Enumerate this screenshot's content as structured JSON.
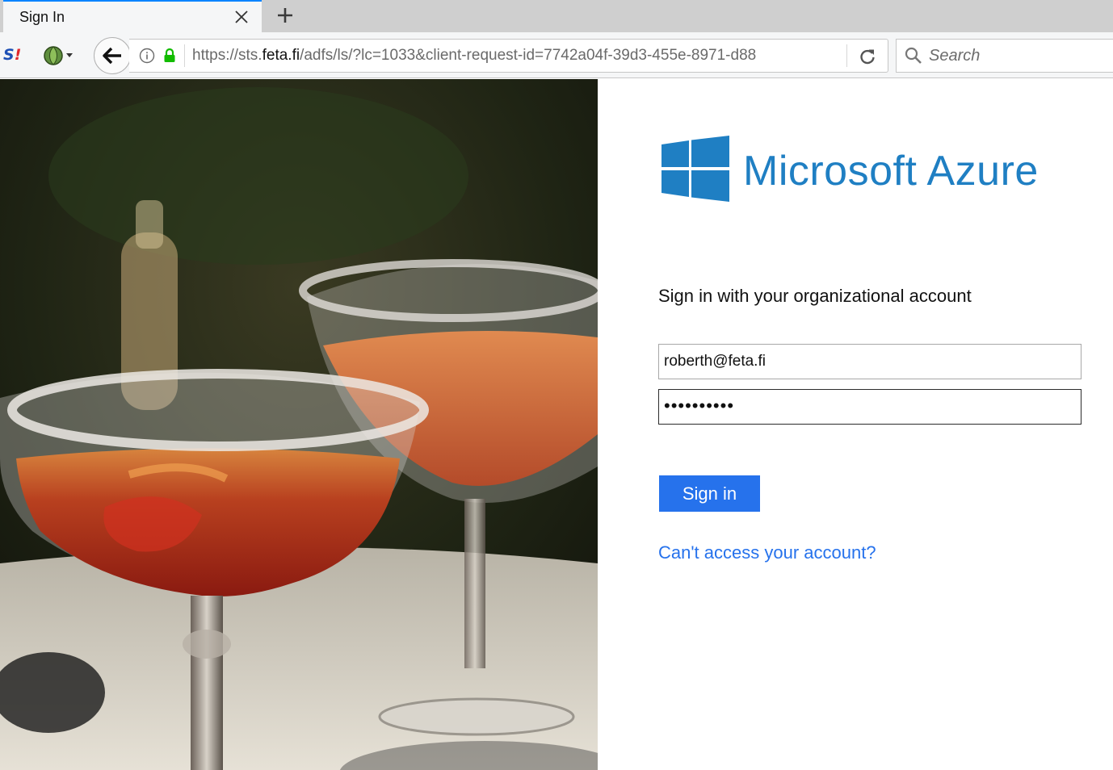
{
  "browser": {
    "tab_title": "Sign In",
    "new_tab_glyph": "+",
    "url_prefix": "https://sts.",
    "url_domain": "feta.fi",
    "url_path": "/adfs/ls/?lc=1033&client-request-id=7742a04f-39d3-455e-8971-d88",
    "search_placeholder": "Search",
    "extension_s_label": "S",
    "extension_s_mark": "!"
  },
  "brand": {
    "name": "Microsoft Azure",
    "logo_icon": "windows-logo-icon",
    "color": "#1f7fc3"
  },
  "form": {
    "prompt": "Sign in with your organizational account",
    "username_value": "roberth@feta.fi",
    "password_value": "••••••••••",
    "submit_label": "Sign in",
    "help_link": "Can't access your account?",
    "accent_color": "#2672ec"
  },
  "icons": {
    "close": "close-icon",
    "new_tab": "plus-icon",
    "back": "back-arrow-icon",
    "info": "info-icon",
    "lock": "lock-icon",
    "reload": "reload-icon",
    "search": "search-icon"
  }
}
